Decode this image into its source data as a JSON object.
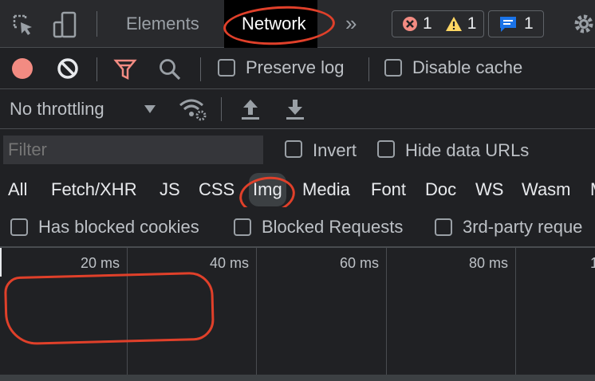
{
  "tabbar": {
    "tabs": [
      "Elements",
      "Network"
    ],
    "active_tab": "Network",
    "more_tabs": "»",
    "errors_count": "1",
    "warnings_count": "1",
    "messages_count": "1"
  },
  "toolbar": {
    "preserve_log": "Preserve log",
    "disable_cache": "Disable cache",
    "throttling": "No throttling"
  },
  "filter": {
    "placeholder": "Filter",
    "invert": "Invert",
    "hide_data_urls": "Hide data URLs"
  },
  "resource_types": [
    "All",
    "Fetch/XHR",
    "JS",
    "CSS",
    "Img",
    "Media",
    "Font",
    "Doc",
    "WS",
    "Wasm",
    "M"
  ],
  "selected_type": "Img",
  "cookies_row": {
    "has_blocked_cookies": "Has blocked cookies",
    "blocked_requests": "Blocked Requests",
    "third_party": "3rd-party reque"
  },
  "timeline": {
    "ticks": [
      "20 ms",
      "40 ms",
      "60 ms",
      "80 ms",
      "1"
    ]
  },
  "colors": {
    "record": "#f28b82",
    "error": "#f28b82",
    "warning": "#fdd663",
    "info": "#1a73e8",
    "filter_icon": "#f28b82",
    "annotation": "#e0402a"
  }
}
